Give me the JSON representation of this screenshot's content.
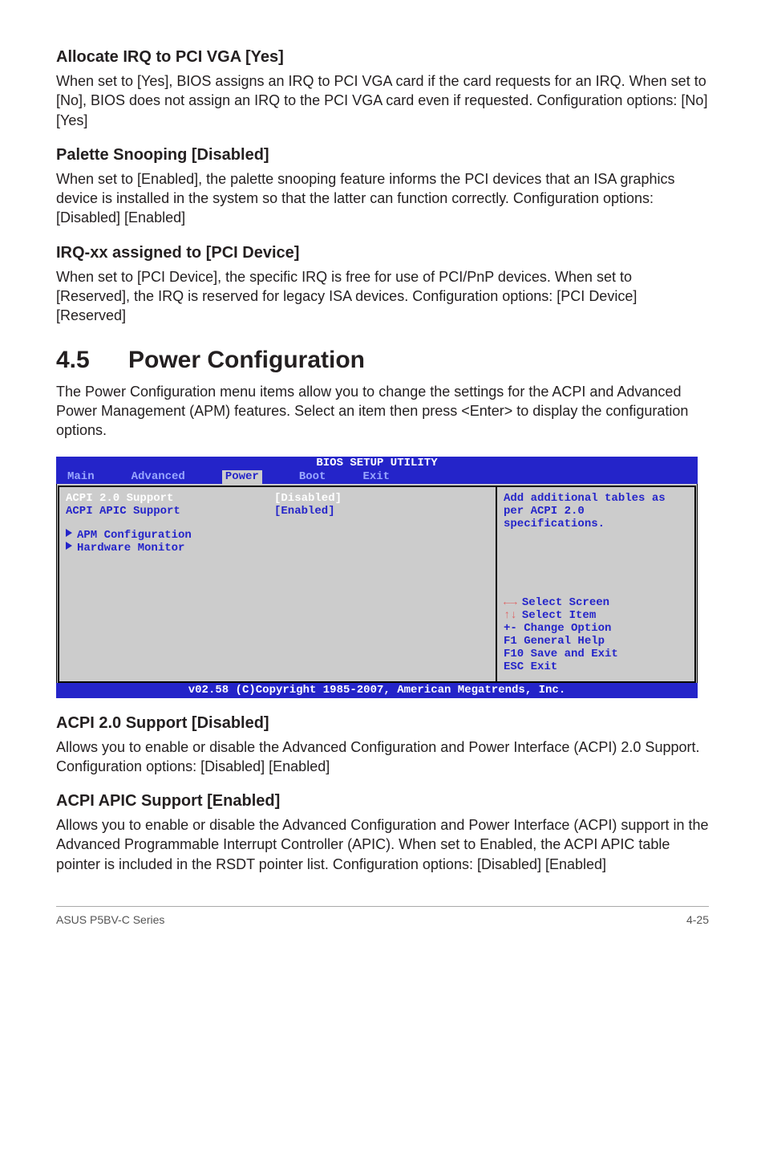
{
  "s1": {
    "title": "Allocate IRQ to PCI VGA [Yes]",
    "body": "When set to [Yes], BIOS assigns an IRQ to PCI VGA card if the card requests for an IRQ. When set to [No], BIOS does not assign an IRQ to the PCI VGA card even if requested. Configuration options: [No] [Yes]"
  },
  "s2": {
    "title": "Palette Snooping [Disabled]",
    "body": "When set to [Enabled], the palette snooping feature informs the PCI devices that an ISA graphics device is installed in the system so that the latter can function correctly. Configuration options: [Disabled] [Enabled]"
  },
  "s3": {
    "title": "IRQ-xx assigned to [PCI Device]",
    "body": "When set to [PCI Device], the specific IRQ is free for use of PCI/PnP devices. When set to [Reserved], the IRQ is reserved for legacy ISA devices. Configuration options: [PCI Device] [Reserved]"
  },
  "chapter": {
    "num": "4.5",
    "title": "Power Configuration",
    "intro": "The Power Configuration menu items allow you to change the settings for the ACPI and Advanced Power Management (APM) features. Select an item then press <Enter> to display the configuration options."
  },
  "bios": {
    "title": "BIOS SETUP UTILITY",
    "tabs": [
      "Main",
      "Advanced",
      "Power",
      "Boot",
      "Exit"
    ],
    "activeTab": "Power",
    "items": {
      "acpi20_label": "ACPI 2.0 Support",
      "acpi20_value": "[Disabled]",
      "apic_label": "ACPI APIC Support",
      "apic_value": "[Enabled]",
      "apm": "APM Configuration",
      "hw": "Hardware Monitor"
    },
    "help": "Add additional tables as per ACPI 2.0 specifications.",
    "keys": {
      "sel_screen": "Select Screen",
      "sel_item": "Select Item",
      "change": "+-  Change Option",
      "general": "F1  General Help",
      "save": "F10 Save and Exit",
      "exit": "ESC Exit"
    },
    "footer": "v02.58 (C)Copyright 1985-2007, American Megatrends, Inc."
  },
  "s4": {
    "title": "ACPI 2.0 Support [Disabled]",
    "body": "Allows you to enable or disable the Advanced Configuration and Power Interface (ACPI) 2.0 Support. Configuration options: [Disabled] [Enabled]"
  },
  "s5": {
    "title": "ACPI APIC Support [Enabled]",
    "body": "Allows you to enable or disable the Advanced Configuration and Power Interface (ACPI) support in the Advanced Programmable Interrupt Controller (APIC). When set to Enabled, the ACPI APIC table pointer is included in the RSDT pointer list. Configuration options: [Disabled] [Enabled]"
  },
  "footer": {
    "left": "ASUS P5BV-C Series",
    "right": "4-25"
  }
}
